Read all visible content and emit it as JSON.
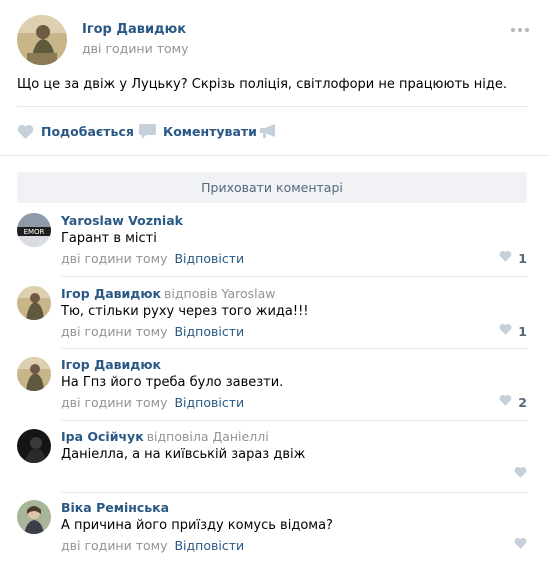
{
  "post": {
    "author": "Ігор Давидюк",
    "time": "дві години тому",
    "text": "Що це за двіж у Луцьку? Скрізь поліція, світлофори не працюють ніде.",
    "more_icon": "more-horizontal-icon",
    "actions": {
      "like_label": "Подобається",
      "comment_label": "Коментувати",
      "share_icon": "megaphone-icon"
    }
  },
  "hide_comments_label": "Приховати коментарі",
  "colors": {
    "link": "#2a5885",
    "muted": "#939393",
    "icon": "#c5d0db",
    "bar": "#f0f2f5"
  },
  "comments": [
    {
      "author": "Yaroslaw Vozniak",
      "reply_to": "",
      "text": "Гарант в місті",
      "time": "дві години тому",
      "reply_label": "Відповісти",
      "likes": "1"
    },
    {
      "author": "Ігор Давидюк",
      "reply_to": "відповів Yaroslaw",
      "text": "Тю, стільки руху через того жида!!!",
      "time": "дві години тому",
      "reply_label": "Відповісти",
      "likes": "1"
    },
    {
      "author": "Ігор Давидюк",
      "reply_to": "",
      "text": "На Гпз його треба було завезти.",
      "time": "дві години тому",
      "reply_label": "Відповісти",
      "likes": "2"
    },
    {
      "author": "Іра Осійчук",
      "reply_to": "відповіла Даніеллі",
      "text": "Даніелла, а на київській зараз двіж",
      "time": "",
      "reply_label": "",
      "likes": ""
    },
    {
      "author": "Віка Ремінська",
      "reply_to": "",
      "text": "А причина його приїзду комусь відома?",
      "time": "дві години тому",
      "reply_label": "Відповісти",
      "likes": ""
    }
  ]
}
